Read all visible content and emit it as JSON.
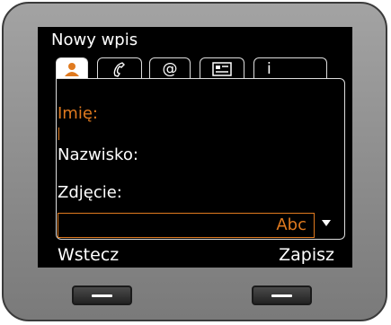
{
  "header": {
    "title": "Nowy wpis"
  },
  "tabs": [
    {
      "id": "person",
      "icon": "person-icon",
      "active": true
    },
    {
      "id": "phone",
      "icon": "phone-handset-icon",
      "active": false
    },
    {
      "id": "email",
      "icon": "at-sign-icon",
      "label": "@",
      "active": false
    },
    {
      "id": "card",
      "icon": "contact-card-icon",
      "active": false
    },
    {
      "id": "info",
      "icon": "info-icon",
      "label": "i",
      "active": false
    }
  ],
  "form": {
    "first_name_label": "Imię:",
    "last_name_label": "Nazwisko:",
    "photo_label": "Zdjęcie:",
    "input_mode": "Abc"
  },
  "softkeys": {
    "left": "Wstecz",
    "right": "Zapisz"
  },
  "colors": {
    "accent": "#e07a1f",
    "screen": "#000000",
    "bezel": "#8c8c8c"
  }
}
